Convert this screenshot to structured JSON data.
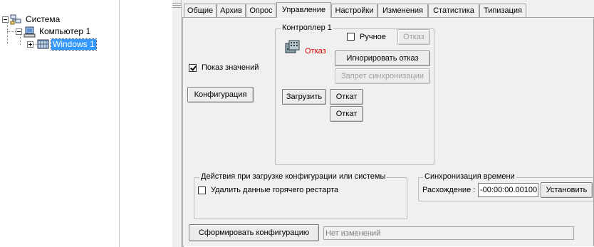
{
  "tree": {
    "root_label": "Система",
    "computer_label": "Компьютер 1",
    "node_label": "Windows 1"
  },
  "tabs": [
    {
      "label": "Общие"
    },
    {
      "label": "Архив"
    },
    {
      "label": "Опрос"
    },
    {
      "label": "Управление"
    },
    {
      "label": "Настройки"
    },
    {
      "label": "Изменения"
    },
    {
      "label": "Статистика"
    },
    {
      "label": "Типизация"
    }
  ],
  "active_tab": "Управление",
  "control": {
    "show_values_label": "Показ значений",
    "show_values_checked": true,
    "config_button": "Конфигурация",
    "controller": {
      "title": "Контроллер 1",
      "manual_label": "Ручное",
      "manual_checked": false,
      "fail_button": "Отказ",
      "status_text": "Отказ",
      "status_color": "#e00000",
      "ignore_fail_button": "Игнорировать отказ",
      "sync_forbid_button": "Запрет синхронизации",
      "load_button": "Загрузить",
      "rollback_button_1": "Откат",
      "rollback_button_2": "Откат"
    },
    "load_actions": {
      "title": "Действия при загрузке конфигурации или системы",
      "delete_hot_restart_label": "Удалить данные горячего рестарта",
      "delete_hot_restart_checked": false
    },
    "time_sync": {
      "title": "Синхронизация времени",
      "diff_label": "Расхождение :",
      "diff_value": "-00:00:00.00100",
      "set_button": "Установить"
    },
    "build_config_button": "Сформировать конфигурацию",
    "changes_status": "Нет изменений"
  }
}
